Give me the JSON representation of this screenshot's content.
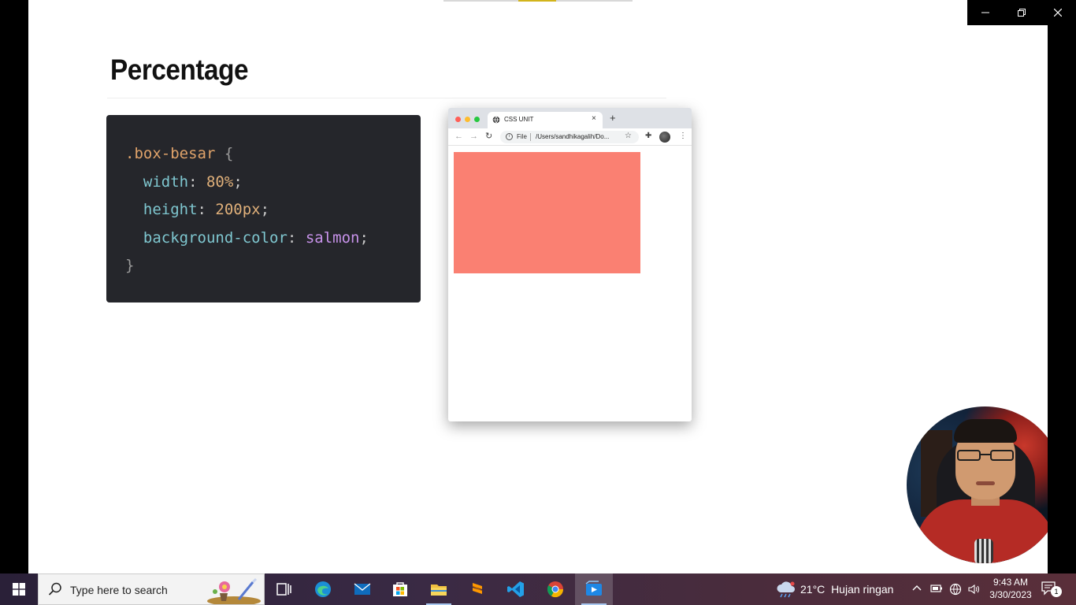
{
  "window": {
    "minimize_icon": "minimize-icon",
    "restore_icon": "restore-icon",
    "close_icon": "close-icon"
  },
  "slide": {
    "title": "Percentage",
    "code": {
      "selector": ".box-besar",
      "open_brace": "{",
      "close_brace": "}",
      "lines": [
        {
          "prop": "width",
          "value": "80%"
        },
        {
          "prop": "height",
          "value": "200px"
        },
        {
          "prop": "background-color",
          "value": "salmon"
        }
      ]
    },
    "browser": {
      "tab_title": "CSS UNIT",
      "tab_close": "×",
      "new_tab": "+",
      "file_label": "File",
      "url": "/Users/sandhikagalih/Do...",
      "box_color": "#fa8072"
    }
  },
  "taskbar": {
    "search_placeholder": "Type here to search",
    "weather": {
      "temp": "21°C",
      "condition": "Hujan ringan"
    },
    "clock": {
      "time": "9:43 AM",
      "date": "3/30/2023"
    },
    "notification_count": "1",
    "pinned": [
      {
        "name": "task-view-icon"
      },
      {
        "name": "edge-icon"
      },
      {
        "name": "mail-icon"
      },
      {
        "name": "store-icon"
      },
      {
        "name": "file-explorer-icon"
      },
      {
        "name": "sublime-text-icon"
      },
      {
        "name": "vscode-icon"
      },
      {
        "name": "chrome-icon"
      },
      {
        "name": "video-player-icon"
      }
    ]
  }
}
